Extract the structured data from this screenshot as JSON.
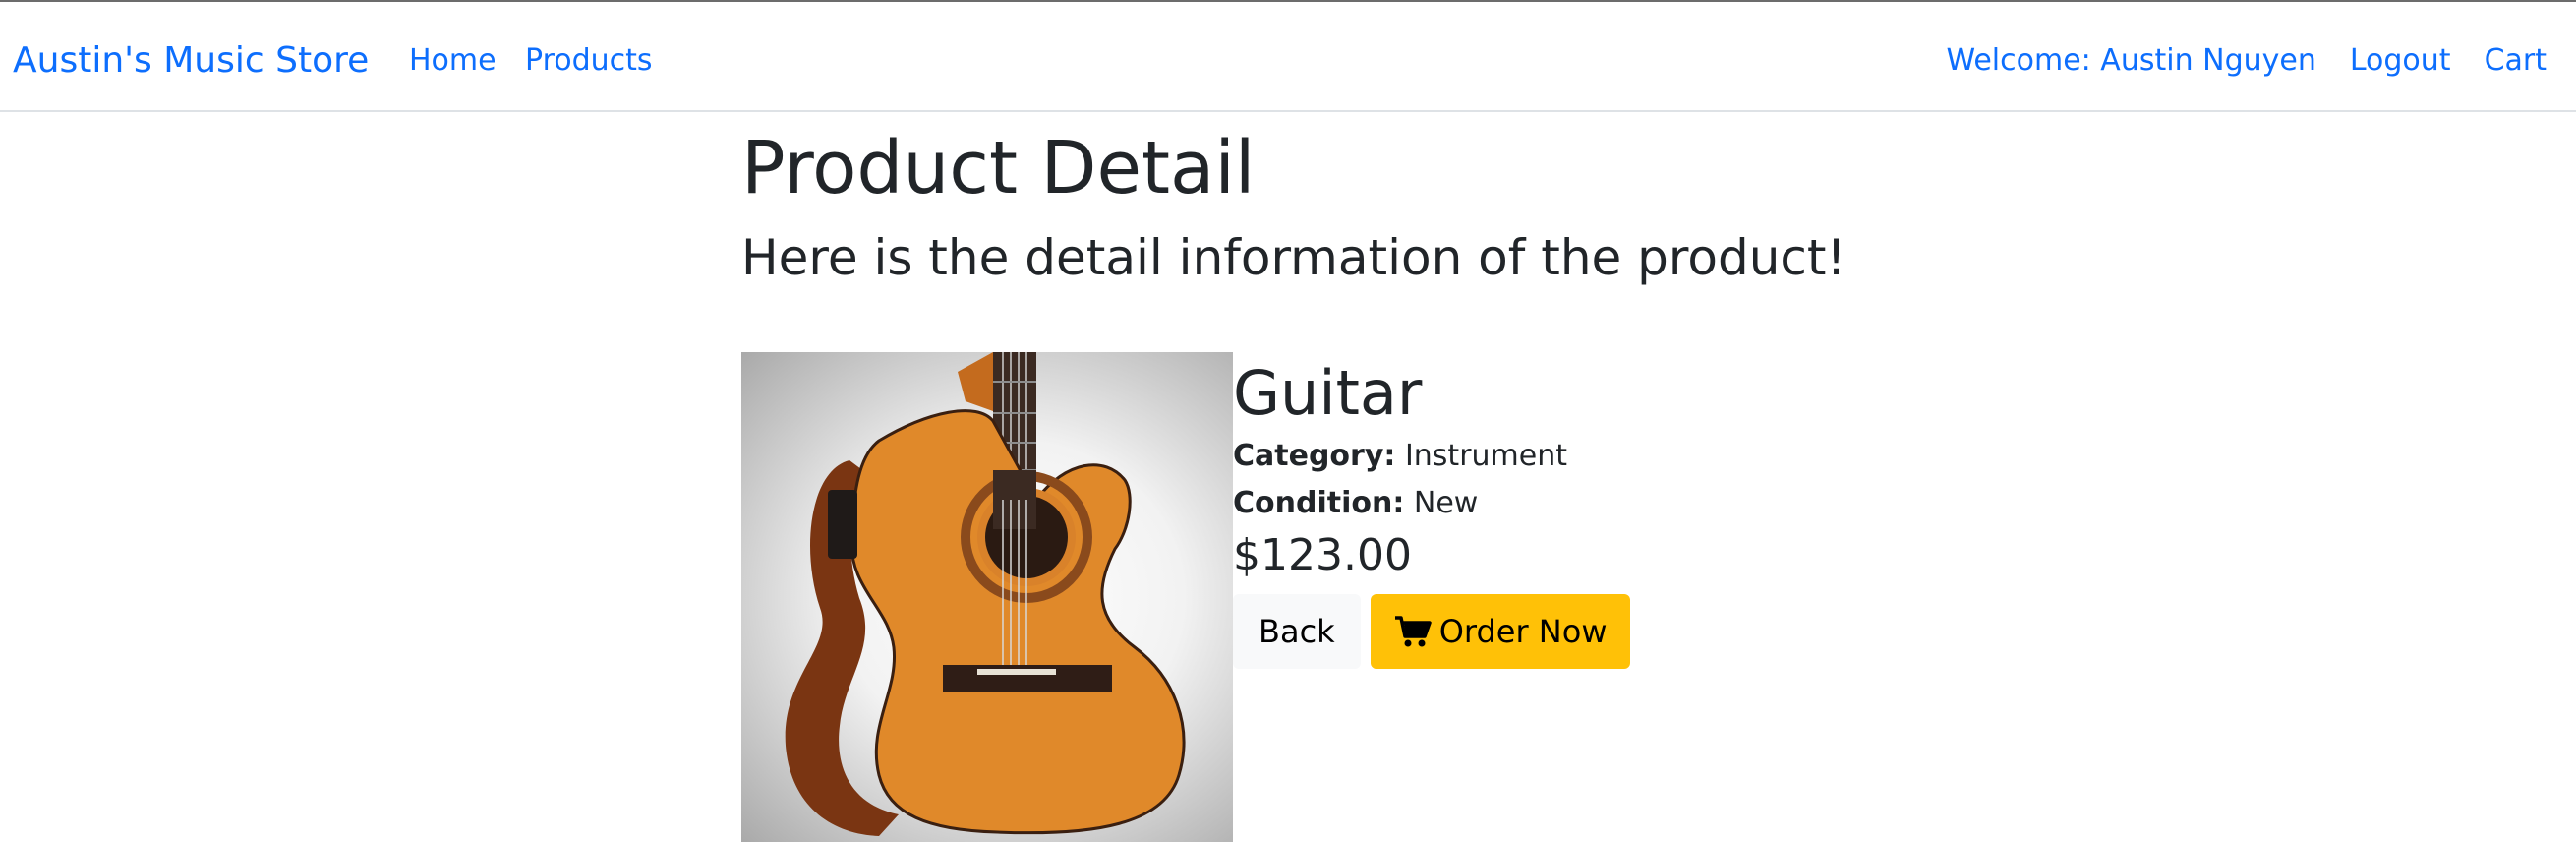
{
  "navbar": {
    "brand": "Austin's Music Store",
    "links": {
      "home": "Home",
      "products": "Products"
    },
    "right": {
      "welcome": "Welcome: Austin Nguyen",
      "logout": "Logout",
      "cart": "Cart"
    }
  },
  "header": {
    "title": "Product Detail",
    "subtitle": "Here is the detail information of the product!"
  },
  "product": {
    "image_icon": "guitar-image",
    "name": "Guitar",
    "category_label": "Category:",
    "category_value": "Instrument",
    "condition_label": "Condition:",
    "condition_value": "New",
    "price": "$123.00"
  },
  "actions": {
    "back_label": "Back",
    "order_label": "Order Now",
    "order_icon": "shopping-cart-icon"
  },
  "colors": {
    "link": "#0d6efd",
    "order_button": "#ffc107",
    "back_button": "#f8f9fa",
    "text": "#212529"
  }
}
